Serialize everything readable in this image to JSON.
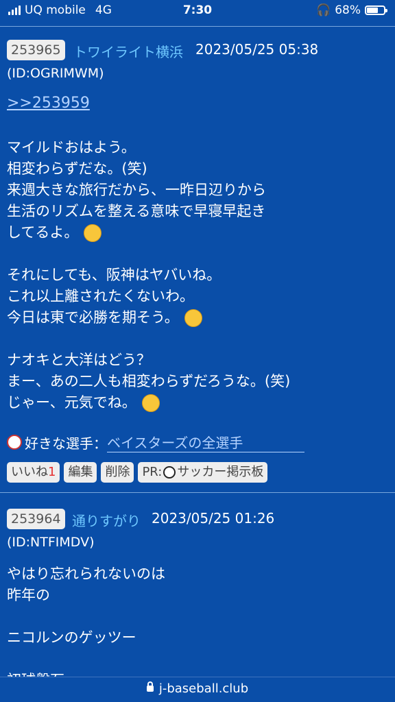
{
  "status_bar": {
    "carrier": "UQ mobile",
    "network": "4G",
    "time": "7:30",
    "battery": "68%",
    "battery_level": 0.68
  },
  "posts": [
    {
      "number": "253965",
      "author": "トワイライト横浜",
      "datetime": "2023/05/25 05:38",
      "id": "(ID:OGRIMWM)",
      "anchor": ">>253959",
      "lines": [
        "マイルドおはよう。",
        "相変わらずだな。(笑)",
        "来週大きな旅行だから、一昨日辺りから",
        "生活のリズムを整える意味で早寝早起き",
        "してるよ。",
        "",
        "それにしても、阪神はヤバいね。",
        "これ以上離されたくないわ。",
        "今日は東で必勝を期そう。",
        "",
        "ナオキと大洋はどう？",
        "まー、あの二人も相変わらずだろうな。(笑)",
        "じゃー、元気でね。"
      ],
      "emoji_icons": [
        "winking-face",
        "smiling-face",
        "smiling-face"
      ],
      "favorite_label": "好きな選手：",
      "favorite_value": "ベイスターズの全選手",
      "buttons": {
        "like": "いいね",
        "like_count": "1",
        "edit": "編集",
        "delete": "削除",
        "pr": "PR:",
        "pr_text": "サッカー掲示板"
      }
    },
    {
      "number": "253964",
      "author": "通りすがり",
      "datetime": "2023/05/25 01:26",
      "id": "(ID:NTFIMDV)",
      "lines": [
        "やはり忘れられないのは",
        "昨年の",
        "",
        "ニコルンのゲッツー",
        "",
        "初球盤石"
      ]
    }
  ],
  "url_bar": {
    "domain": "j-baseball.club"
  },
  "colors": {
    "background": "#0a4ea8",
    "author": "#6fc8ff",
    "link": "#b6d4ff",
    "like_count": "#e53030"
  }
}
